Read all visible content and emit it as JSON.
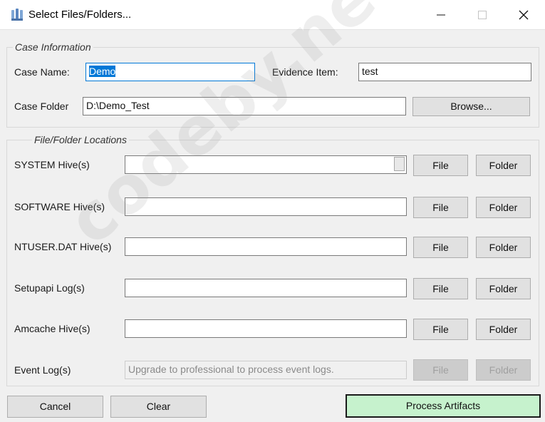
{
  "window": {
    "title": "Select Files/Folders...",
    "app_icon": "registry-explorer-icon"
  },
  "case_info": {
    "group_title": "Case Information",
    "case_name_label": "Case Name:",
    "case_name_value": "Demo",
    "evidence_item_label": "Evidence Item:",
    "evidence_item_value": "test",
    "case_folder_label": "Case Folder",
    "case_folder_value": "D:\\Demo_Test",
    "browse_label": "Browse..."
  },
  "locations": {
    "group_title": "File/Folder Locations",
    "file_label": "File",
    "folder_label": "Folder",
    "rows": [
      {
        "label": "SYSTEM Hive(s)",
        "value": ""
      },
      {
        "label": "SOFTWARE Hive(s)",
        "value": ""
      },
      {
        "label": "NTUSER.DAT Hive(s)",
        "value": ""
      },
      {
        "label": "Setupapi Log(s)",
        "value": ""
      },
      {
        "label": "Amcache Hive(s)",
        "value": ""
      },
      {
        "label": "Event Log(s)",
        "value": "",
        "placeholder": "Upgrade to professional to process event logs.",
        "disabled": true
      }
    ]
  },
  "footer": {
    "cancel_label": "Cancel",
    "clear_label": "Clear",
    "process_label": "Process Artifacts"
  },
  "watermark": "codeby.net",
  "colors": {
    "accent": "#0078d7",
    "primary_button": "#c6f2cd"
  }
}
